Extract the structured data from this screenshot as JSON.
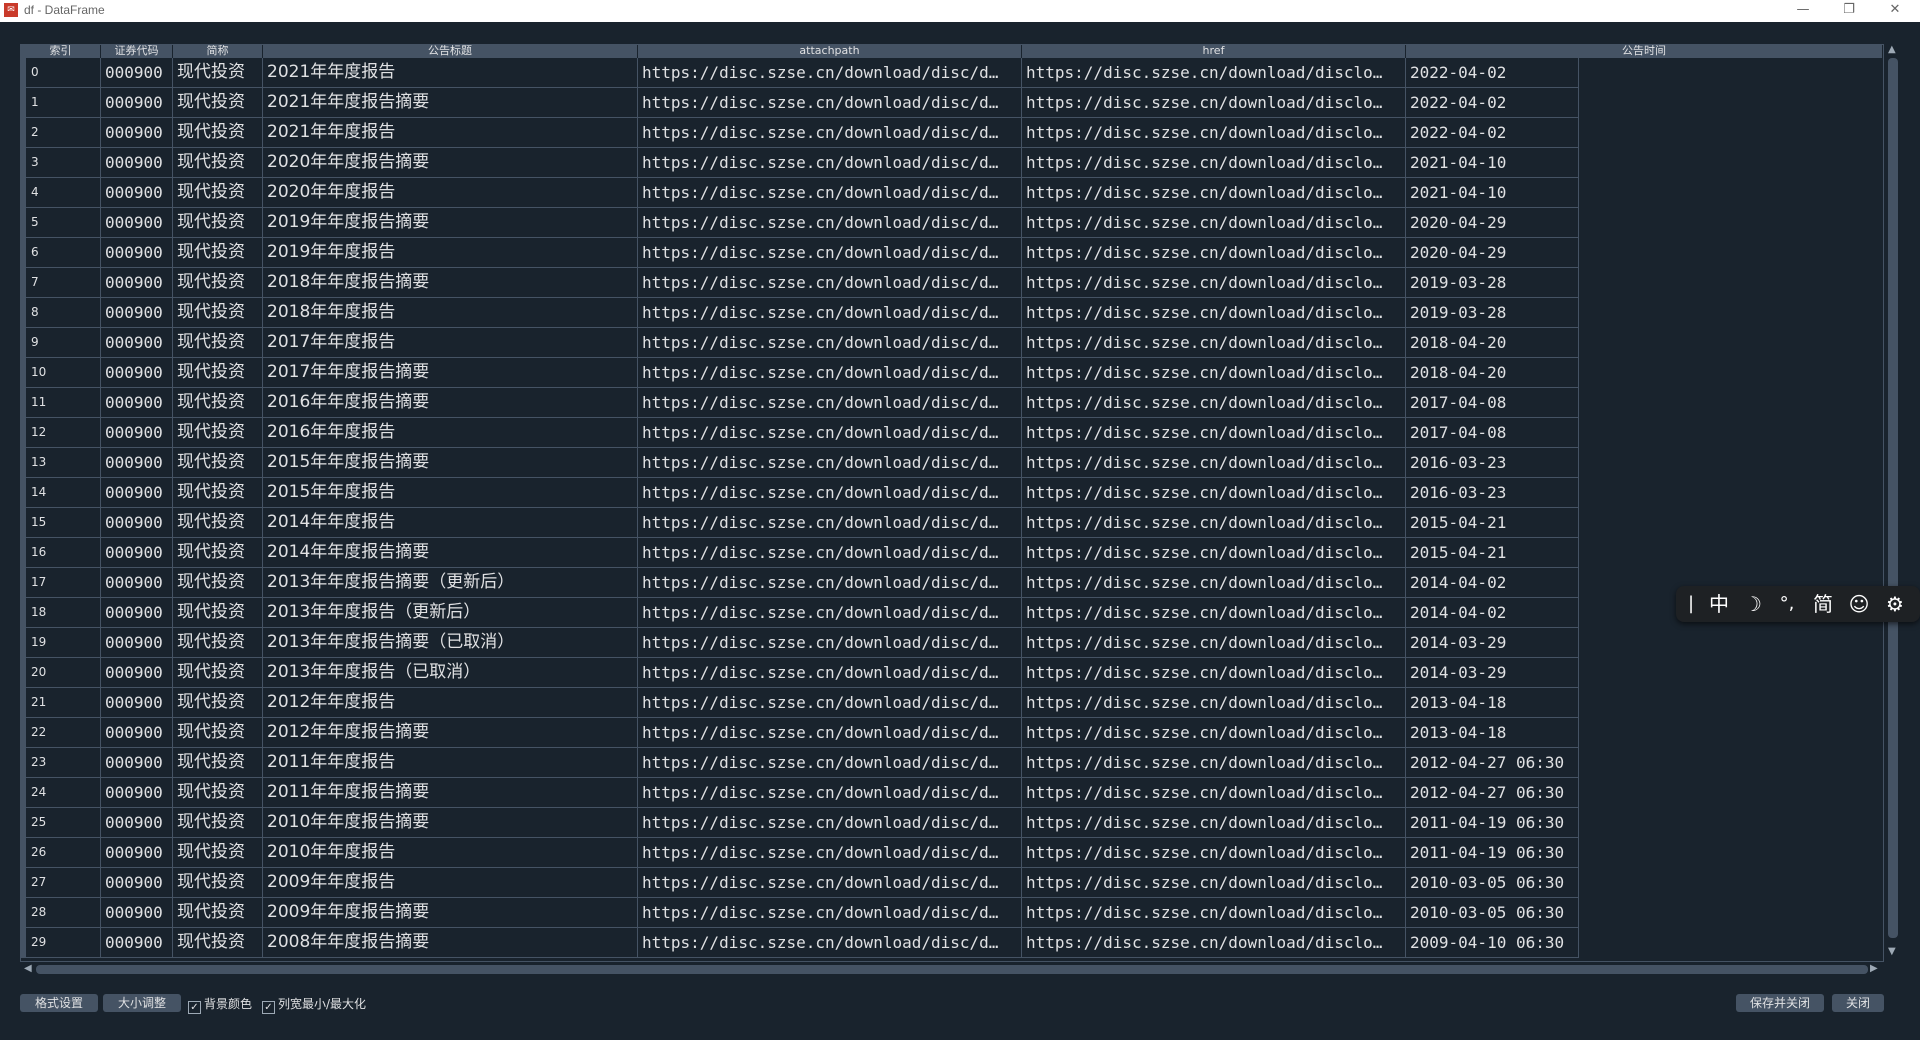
{
  "window": {
    "title": "df - DataFrame",
    "app_icon": "app-logo",
    "controls": {
      "minimize": "—",
      "restore": "❐",
      "close": "✕"
    }
  },
  "table": {
    "headers": {
      "index": "索引",
      "col1": "证券代码",
      "col2": "简称",
      "col3": "公告标题",
      "col4": "attachpath",
      "col5": "href",
      "col6": "公告时间"
    },
    "rows": [
      {
        "i": "0",
        "code": "000900",
        "name": "现代投资",
        "title": "2021年年度报告",
        "attach": "https://disc.szse.cn/download/disc/d…",
        "href": "https://disc.szse.cn/download/disclo…",
        "time": "2022-04-02"
      },
      {
        "i": "1",
        "code": "000900",
        "name": "现代投资",
        "title": "2021年年度报告摘要",
        "attach": "https://disc.szse.cn/download/disc/d…",
        "href": "https://disc.szse.cn/download/disclo…",
        "time": "2022-04-02"
      },
      {
        "i": "2",
        "code": "000900",
        "name": "现代投资",
        "title": "2021年年度报告",
        "attach": "https://disc.szse.cn/download/disc/d…",
        "href": "https://disc.szse.cn/download/disclo…",
        "time": "2022-04-02"
      },
      {
        "i": "3",
        "code": "000900",
        "name": "现代投资",
        "title": "2020年年度报告摘要",
        "attach": "https://disc.szse.cn/download/disc/d…",
        "href": "https://disc.szse.cn/download/disclo…",
        "time": "2021-04-10"
      },
      {
        "i": "4",
        "code": "000900",
        "name": "现代投资",
        "title": "2020年年度报告",
        "attach": "https://disc.szse.cn/download/disc/d…",
        "href": "https://disc.szse.cn/download/disclo…",
        "time": "2021-04-10"
      },
      {
        "i": "5",
        "code": "000900",
        "name": "现代投资",
        "title": "2019年年度报告摘要",
        "attach": "https://disc.szse.cn/download/disc/d…",
        "href": "https://disc.szse.cn/download/disclo…",
        "time": "2020-04-29"
      },
      {
        "i": "6",
        "code": "000900",
        "name": "现代投资",
        "title": "2019年年度报告",
        "attach": "https://disc.szse.cn/download/disc/d…",
        "href": "https://disc.szse.cn/download/disclo…",
        "time": "2020-04-29"
      },
      {
        "i": "7",
        "code": "000900",
        "name": "现代投资",
        "title": "2018年年度报告摘要",
        "attach": "https://disc.szse.cn/download/disc/d…",
        "href": "https://disc.szse.cn/download/disclo…",
        "time": "2019-03-28"
      },
      {
        "i": "8",
        "code": "000900",
        "name": "现代投资",
        "title": "2018年年度报告",
        "attach": "https://disc.szse.cn/download/disc/d…",
        "href": "https://disc.szse.cn/download/disclo…",
        "time": "2019-03-28"
      },
      {
        "i": "9",
        "code": "000900",
        "name": "现代投资",
        "title": "2017年年度报告",
        "attach": "https://disc.szse.cn/download/disc/d…",
        "href": "https://disc.szse.cn/download/disclo…",
        "time": "2018-04-20"
      },
      {
        "i": "10",
        "code": "000900",
        "name": "现代投资",
        "title": "2017年年度报告摘要",
        "attach": "https://disc.szse.cn/download/disc/d…",
        "href": "https://disc.szse.cn/download/disclo…",
        "time": "2018-04-20"
      },
      {
        "i": "11",
        "code": "000900",
        "name": "现代投资",
        "title": "2016年年度报告摘要",
        "attach": "https://disc.szse.cn/download/disc/d…",
        "href": "https://disc.szse.cn/download/disclo…",
        "time": "2017-04-08"
      },
      {
        "i": "12",
        "code": "000900",
        "name": "现代投资",
        "title": "2016年年度报告",
        "attach": "https://disc.szse.cn/download/disc/d…",
        "href": "https://disc.szse.cn/download/disclo…",
        "time": "2017-04-08"
      },
      {
        "i": "13",
        "code": "000900",
        "name": "现代投资",
        "title": "2015年年度报告摘要",
        "attach": "https://disc.szse.cn/download/disc/d…",
        "href": "https://disc.szse.cn/download/disclo…",
        "time": "2016-03-23"
      },
      {
        "i": "14",
        "code": "000900",
        "name": "现代投资",
        "title": "2015年年度报告",
        "attach": "https://disc.szse.cn/download/disc/d…",
        "href": "https://disc.szse.cn/download/disclo…",
        "time": "2016-03-23"
      },
      {
        "i": "15",
        "code": "000900",
        "name": "现代投资",
        "title": "2014年年度报告",
        "attach": "https://disc.szse.cn/download/disc/d…",
        "href": "https://disc.szse.cn/download/disclo…",
        "time": "2015-04-21"
      },
      {
        "i": "16",
        "code": "000900",
        "name": "现代投资",
        "title": "2014年年度报告摘要",
        "attach": "https://disc.szse.cn/download/disc/d…",
        "href": "https://disc.szse.cn/download/disclo…",
        "time": "2015-04-21"
      },
      {
        "i": "17",
        "code": "000900",
        "name": "现代投资",
        "title": "2013年年度报告摘要（更新后）",
        "attach": "https://disc.szse.cn/download/disc/d…",
        "href": "https://disc.szse.cn/download/disclo…",
        "time": "2014-04-02"
      },
      {
        "i": "18",
        "code": "000900",
        "name": "现代投资",
        "title": "2013年年度报告（更新后）",
        "attach": "https://disc.szse.cn/download/disc/d…",
        "href": "https://disc.szse.cn/download/disclo…",
        "time": "2014-04-02"
      },
      {
        "i": "19",
        "code": "000900",
        "name": "现代投资",
        "title": "2013年年度报告摘要（已取消）",
        "attach": "https://disc.szse.cn/download/disc/d…",
        "href": "https://disc.szse.cn/download/disclo…",
        "time": "2014-03-29"
      },
      {
        "i": "20",
        "code": "000900",
        "name": "现代投资",
        "title": "2013年年度报告（已取消）",
        "attach": "https://disc.szse.cn/download/disc/d…",
        "href": "https://disc.szse.cn/download/disclo…",
        "time": "2014-03-29"
      },
      {
        "i": "21",
        "code": "000900",
        "name": "现代投资",
        "title": "2012年年度报告",
        "attach": "https://disc.szse.cn/download/disc/d…",
        "href": "https://disc.szse.cn/download/disclo…",
        "time": "2013-04-18"
      },
      {
        "i": "22",
        "code": "000900",
        "name": "现代投资",
        "title": "2012年年度报告摘要",
        "attach": "https://disc.szse.cn/download/disc/d…",
        "href": "https://disc.szse.cn/download/disclo…",
        "time": "2013-04-18"
      },
      {
        "i": "23",
        "code": "000900",
        "name": "现代投资",
        "title": "2011年年度报告",
        "attach": "https://disc.szse.cn/download/disc/d…",
        "href": "https://disc.szse.cn/download/disclo…",
        "time": "2012-04-27 06:30"
      },
      {
        "i": "24",
        "code": "000900",
        "name": "现代投资",
        "title": "2011年年度报告摘要",
        "attach": "https://disc.szse.cn/download/disc/d…",
        "href": "https://disc.szse.cn/download/disclo…",
        "time": "2012-04-27 06:30"
      },
      {
        "i": "25",
        "code": "000900",
        "name": "现代投资",
        "title": "2010年年度报告摘要",
        "attach": "https://disc.szse.cn/download/disc/d…",
        "href": "https://disc.szse.cn/download/disclo…",
        "time": "2011-04-19 06:30"
      },
      {
        "i": "26",
        "code": "000900",
        "name": "现代投资",
        "title": "2010年年度报告",
        "attach": "https://disc.szse.cn/download/disc/d…",
        "href": "https://disc.szse.cn/download/disclo…",
        "time": "2011-04-19 06:30"
      },
      {
        "i": "27",
        "code": "000900",
        "name": "现代投资",
        "title": "2009年年度报告",
        "attach": "https://disc.szse.cn/download/disc/d…",
        "href": "https://disc.szse.cn/download/disclo…",
        "time": "2010-03-05 06:30"
      },
      {
        "i": "28",
        "code": "000900",
        "name": "现代投资",
        "title": "2009年年度报告摘要",
        "attach": "https://disc.szse.cn/download/disc/d…",
        "href": "https://disc.szse.cn/download/disclo…",
        "time": "2010-03-05 06:30"
      },
      {
        "i": "29",
        "code": "000900",
        "name": "现代投资",
        "title": "2008年年度报告摘要",
        "attach": "https://disc.szse.cn/download/disc/d…",
        "href": "https://disc.szse.cn/download/disclo…",
        "time": "2009-04-10 06:30"
      }
    ]
  },
  "bottom": {
    "format_button": "格式设置",
    "resize_button": "大小调整",
    "bg_color_checkbox": {
      "label": "背景颜色",
      "checked": true
    },
    "col_width_checkbox": {
      "label": "列宽最小/最大化",
      "checked": true
    },
    "save_close_button": "保存并关闭",
    "close_button": "关闭"
  },
  "ime_toolbar": {
    "cursor": "|",
    "mode": "中",
    "theme_icon": "moon-icon",
    "punct": "°,",
    "script": "简",
    "emoji_icon": "smiley-icon",
    "settings_icon": "gear-icon"
  },
  "colors": {
    "background": "#19232d",
    "grid": "#455364",
    "text": "#e0e1e3"
  }
}
